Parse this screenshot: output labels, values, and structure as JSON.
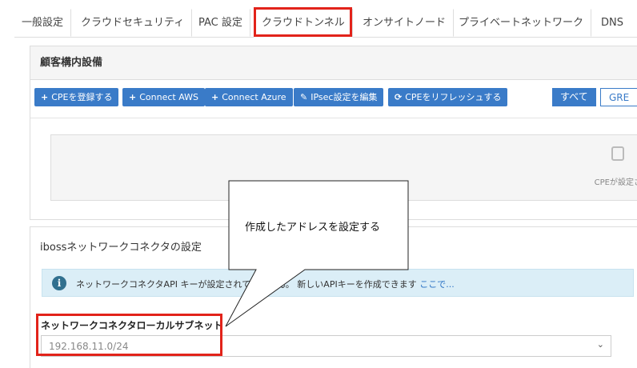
{
  "tabs": [
    {
      "label": "一般設定"
    },
    {
      "label": "クラウドセキュリティ"
    },
    {
      "label": "PAC 設定"
    },
    {
      "label": "クラウドトンネル"
    },
    {
      "label": "オンサイトノード"
    },
    {
      "label": "プライベートネットワーク"
    },
    {
      "label": "DNS"
    }
  ],
  "cpe_panel": {
    "title": "顧客構内設備",
    "buttons": {
      "register_cpe": "CPEを登録する",
      "connect_aws": "Connect AWS",
      "connect_azure": "Connect Azure",
      "edit_ipsec": "IPsec設定を編集",
      "refresh_cpe": "CPEをリフレッシュする"
    },
    "filter": {
      "all": "すべて",
      "green": "GRE"
    },
    "empty_text": "CPEが設定さ"
  },
  "connector_panel": {
    "title": "ibossネットワークコネクタの設定",
    "info_text": "ネットワークコネクタAPI キーが設定されていません。 新しいAPIキーを作成できます",
    "info_link": "ここで...",
    "subnet_label": "ネットワークコネクタローカルサブネット",
    "subnet_value": "192.168.11.0/24"
  },
  "callout": {
    "text": "作成したアドレスを設定する"
  },
  "colors": {
    "accent": "#3a7bc8",
    "highlight": "#e2231a",
    "info_bg": "#dbeef7"
  },
  "icons": {
    "plus": "plus-icon",
    "pencil": "pencil-icon",
    "refresh": "refresh-icon",
    "info": "info-icon"
  }
}
